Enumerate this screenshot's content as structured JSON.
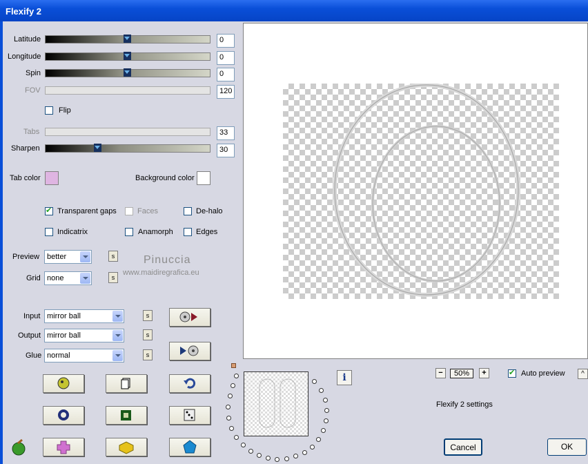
{
  "window": {
    "title": "Flexify 2"
  },
  "controls": {
    "latitude": {
      "label": "Latitude",
      "value": "0"
    },
    "longitude": {
      "label": "Longitude",
      "value": "0"
    },
    "spin": {
      "label": "Spin",
      "value": "0"
    },
    "fov": {
      "label": "FOV",
      "value": "120"
    },
    "flip": {
      "label": "Flip"
    },
    "tabs": {
      "label": "Tabs",
      "value": "33"
    },
    "sharpen": {
      "label": "Sharpen",
      "value": "30"
    }
  },
  "colors": {
    "tab_color_label": "Tab color",
    "tab_color": "#dfb5e2",
    "background_color_label": "Background color",
    "background_color": "#ffffff"
  },
  "options": {
    "transparent_gaps": "Transparent gaps",
    "faces": "Faces",
    "dehalo": "De-halo",
    "indicatrix": "Indicatrix",
    "anamorph": "Anamorph",
    "edges": "Edges"
  },
  "preview_setting": {
    "label": "Preview",
    "value": "better"
  },
  "grid_setting": {
    "label": "Grid",
    "value": "none"
  },
  "input": {
    "label": "Input",
    "value": "mirror ball"
  },
  "output": {
    "label": "Output",
    "value": "mirror ball"
  },
  "glue": {
    "label": "Glue",
    "value": "normal"
  },
  "save_btn": "s",
  "watermark": {
    "name": "Pinuccia",
    "url": "www.maidiregrafica.eu"
  },
  "zoom": {
    "minus": "−",
    "value": "50%",
    "plus": "+"
  },
  "auto_preview": "Auto preview",
  "scroll_up": "^",
  "settings_label": "Flexify 2 settings",
  "info": "i",
  "buttons": {
    "cancel": "Cancel",
    "ok": "OK"
  }
}
